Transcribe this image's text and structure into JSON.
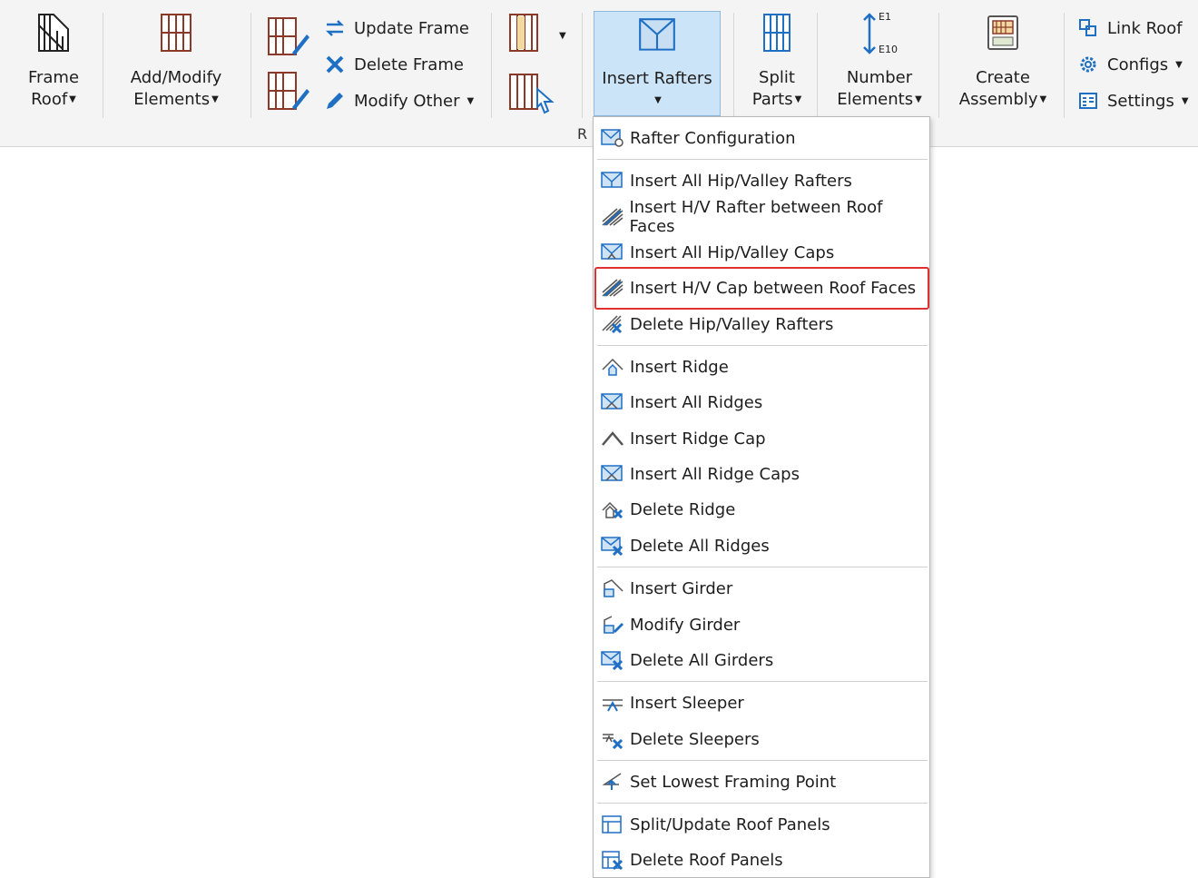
{
  "ribbon": {
    "frame_roof": {
      "line1": "Frame",
      "line2": "Roof"
    },
    "add_modify": {
      "line1": "Add/Modify",
      "line2": "Elements"
    },
    "update_frame": "Update Frame",
    "delete_frame": "Delete Frame",
    "modify_other": "Modify Other",
    "insert_rafters": "Insert Rafters",
    "split_parts": {
      "line1": "Split",
      "line2": "Parts"
    },
    "number_elements": {
      "line1": "Number",
      "line2": "Elements",
      "icon_top": "E1",
      "icon_bottom": "E10"
    },
    "create_assembly": {
      "line1": "Create",
      "line2": "Assembly"
    },
    "link_roof": "Link Roof",
    "configs": "Configs",
    "settings": "Settings",
    "group_caption": "R"
  },
  "menu": {
    "items": [
      {
        "label": "Rafter Configuration",
        "icon": "rafter-config-icon"
      },
      {
        "label": "Insert All Hip/Valley Rafters",
        "icon": "hip-valley-rafters-icon"
      },
      {
        "label": "Insert H/V Rafter between Roof Faces",
        "icon": "hv-rafter-faces-icon"
      },
      {
        "label": "Insert All Hip/Valley Caps",
        "icon": "hip-valley-caps-icon"
      },
      {
        "label": "Insert H/V Cap between Roof Faces",
        "icon": "hv-cap-faces-icon"
      },
      {
        "label": "Delete Hip/Valley Rafters",
        "icon": "delete-hip-valley-icon"
      },
      {
        "label": "Insert Ridge",
        "icon": "insert-ridge-icon"
      },
      {
        "label": "Insert All Ridges",
        "icon": "insert-all-ridges-icon"
      },
      {
        "label": "Insert Ridge Cap",
        "icon": "ridge-cap-icon"
      },
      {
        "label": "Insert All Ridge Caps",
        "icon": "all-ridge-caps-icon"
      },
      {
        "label": "Delete Ridge",
        "icon": "delete-ridge-icon"
      },
      {
        "label": "Delete All Ridges",
        "icon": "delete-all-ridges-icon"
      },
      {
        "label": "Insert Girder",
        "icon": "insert-girder-icon"
      },
      {
        "label": "Modify Girder",
        "icon": "modify-girder-icon"
      },
      {
        "label": "Delete All Girders",
        "icon": "delete-girders-icon"
      },
      {
        "label": "Insert Sleeper",
        "icon": "insert-sleeper-icon"
      },
      {
        "label": "Delete Sleepers",
        "icon": "delete-sleepers-icon"
      },
      {
        "label": "Set Lowest Framing Point",
        "icon": "lowest-point-icon"
      },
      {
        "label": "Split/Update Roof Panels",
        "icon": "split-panels-icon"
      },
      {
        "label": "Delete Roof Panels",
        "icon": "delete-panels-icon"
      }
    ]
  },
  "colors": {
    "accent": "#1f6fc5",
    "highlight_border": "#e03030",
    "selected_button_bg": "#cce4f7",
    "icon_brown": "#8b3a2a"
  }
}
